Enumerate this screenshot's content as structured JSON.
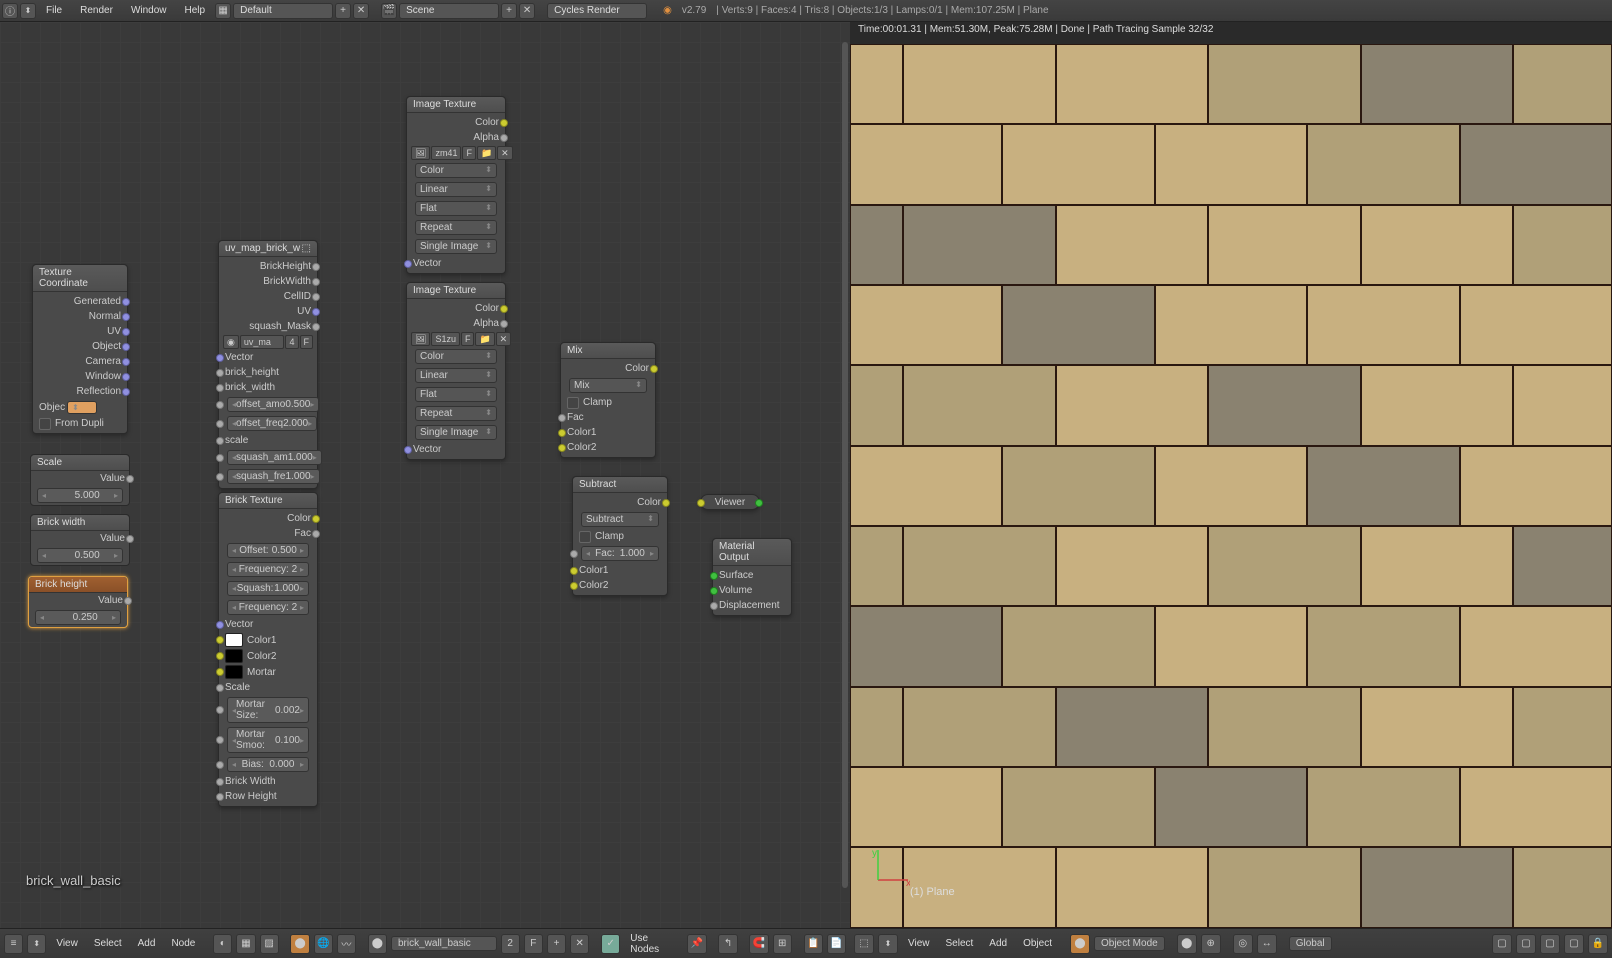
{
  "header": {
    "menus": [
      "File",
      "Render",
      "Window",
      "Help"
    ],
    "layout": "Default",
    "scene": "Scene",
    "engine": "Cycles Render",
    "version": "v2.79",
    "stats": "Verts:9 | Faces:4 | Tris:8 | Objects:1/3 | Lamps:0/1 | Mem:107.25M | Plane"
  },
  "render": {
    "status": "Time:00:01.31 | Mem:51.30M, Peak:75.28M | Done | Path Tracing Sample 32/32",
    "object_label": "(1) Plane"
  },
  "nodes": {
    "tex_coord": {
      "title": "Texture Coordinate",
      "outputs": [
        "Generated",
        "Normal",
        "UV",
        "Object",
        "Camera",
        "Window",
        "Reflection"
      ],
      "object_label": "Objec",
      "from_dupli": "From Dupli"
    },
    "scale": {
      "title": "Scale",
      "value_label": "Value",
      "value": "5.000"
    },
    "brick_width": {
      "title": "Brick width",
      "value_label": "Value",
      "value": "0.500"
    },
    "brick_height": {
      "title": "Brick height",
      "value_label": "Value",
      "value": "0.250"
    },
    "uv_group": {
      "title": "uv_map_brick_w",
      "outputs": [
        "BrickHeight",
        "BrickWidth",
        "CellID",
        "UV",
        "squash_Mask"
      ],
      "img_field": "uv_ma",
      "img_users": "4",
      "inputs": [
        "Vector",
        "brick_height",
        "brick_width"
      ],
      "params": [
        {
          "name": "offset_amo",
          "val": "0.500"
        },
        {
          "name": "offset_freq",
          "val": "2.000"
        }
      ],
      "scale_label": "scale",
      "params2": [
        {
          "name": "squash_am",
          "val": "1.000"
        },
        {
          "name": "squash_fre",
          "val": "1.000"
        }
      ]
    },
    "img_tex1": {
      "title": "Image Texture",
      "outputs": [
        "Color",
        "Alpha"
      ],
      "img_field": "zm41",
      "dropdowns": [
        "Color",
        "Linear",
        "Flat",
        "Repeat",
        "Single Image"
      ],
      "vector": "Vector"
    },
    "img_tex2": {
      "title": "Image Texture",
      "outputs": [
        "Color",
        "Alpha"
      ],
      "img_field": "S1zu",
      "dropdowns": [
        "Color",
        "Linear",
        "Flat",
        "Repeat",
        "Single Image"
      ],
      "vector": "Vector"
    },
    "mix": {
      "title": "Mix",
      "color_out": "Color",
      "blend": "Mix",
      "clamp": "Clamp",
      "inputs": [
        "Fac",
        "Color1",
        "Color2"
      ]
    },
    "subtract": {
      "title": "Subtract",
      "color_out": "Color",
      "blend": "Subtract",
      "clamp": "Clamp",
      "fac_label": "Fac:",
      "fac_val": "1.000",
      "inputs": [
        "Color1",
        "Color2"
      ]
    },
    "brick_tex": {
      "title": "Brick Texture",
      "outputs": [
        "Color",
        "Fac"
      ],
      "params_top": [
        {
          "name": "Offset:",
          "val": "0.500"
        },
        {
          "name": "Frequency:",
          "val": "2"
        },
        {
          "name": "Squash:",
          "val": "1.000"
        },
        {
          "name": "Frequency:",
          "val": "2"
        }
      ],
      "vector": "Vector",
      "color_inputs": [
        "Color1",
        "Color2",
        "Mortar"
      ],
      "scale_label": "Scale",
      "params_bot": [
        {
          "name": "Mortar Size:",
          "val": "0.002"
        },
        {
          "name": "Mortar Smoo:",
          "val": "0.100"
        },
        {
          "name": "Bias:",
          "val": "0.000"
        }
      ],
      "sockets_bot": [
        "Brick Width",
        "Row Height"
      ]
    },
    "viewer": {
      "title": "Viewer"
    },
    "mat_output": {
      "title": "Material Output",
      "inputs": [
        "Surface",
        "Volume",
        "Displacement"
      ]
    }
  },
  "material_name": "brick_wall_basic",
  "node_toolbar": {
    "menus": [
      "View",
      "Select",
      "Add",
      "Node"
    ],
    "material": "brick_wall_basic",
    "users": "2",
    "fake": "F",
    "use_nodes": "Use Nodes"
  },
  "view3d_toolbar": {
    "menus": [
      "View",
      "Select",
      "Add",
      "Object"
    ],
    "mode": "Object Mode",
    "orientation": "Global"
  }
}
